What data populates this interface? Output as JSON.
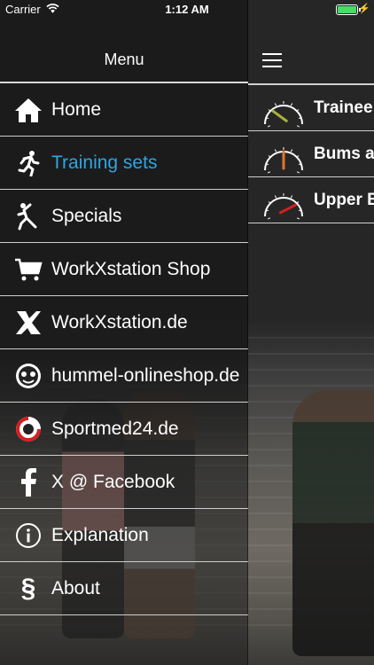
{
  "status_bar": {
    "carrier": "Carrier",
    "time": "1:12 AM",
    "battery_level": 1.0,
    "battery_color": "#4cd964"
  },
  "menu": {
    "title": "Menu",
    "active_color": "#2da5e6",
    "items": [
      {
        "label": "Home",
        "icon": "home-icon"
      },
      {
        "label": "Training sets",
        "icon": "running-person-icon",
        "active": true
      },
      {
        "label": "Specials",
        "icon": "kicking-person-icon"
      },
      {
        "label": "WorkXstation Shop",
        "icon": "shopping-cart-icon"
      },
      {
        "label": "WorkXstation.de",
        "icon": "workxstation-logo-icon"
      },
      {
        "label": "hummel-onlineshop.de",
        "icon": "hummel-logo-icon"
      },
      {
        "label": "Sportmed24.de",
        "icon": "sportmed-logo-icon"
      },
      {
        "label": "X @ Facebook",
        "icon": "facebook-icon"
      },
      {
        "label": "Explanation",
        "icon": "info-icon"
      },
      {
        "label": "About",
        "icon": "section-sign-icon"
      }
    ]
  },
  "training_plans": [
    {
      "label": "Trainee",
      "gauge_color": "#a8b238",
      "gauge_level": 0.2
    },
    {
      "label": "Bums a",
      "gauge_color": "#e0762a",
      "gauge_level": 0.5
    },
    {
      "label": "Upper B",
      "gauge_color": "#d42020",
      "gauge_level": 0.85
    }
  ]
}
